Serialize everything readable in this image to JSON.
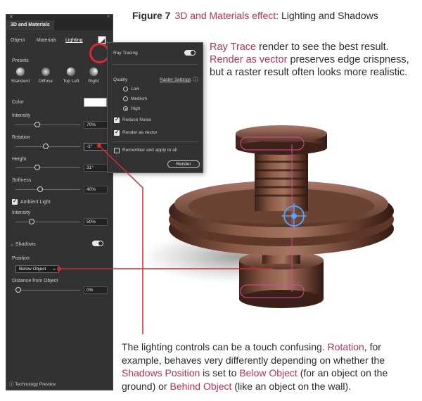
{
  "figure": {
    "number": "Figure 7",
    "title_accent": "3D and Materials effect",
    "title_rest": ": Lighting and Shadows"
  },
  "callout_top": {
    "p1_accent": "Ray Trace",
    "p1_rest": " render to see the best result.",
    "p2_accent": "Render as vector",
    "p2_rest": " preserves edge crispness, but a raster result often looks more realistic."
  },
  "callout_bottom": {
    "t1": "The lighting controls can be a touch confusing. ",
    "rotation": "Rotation",
    "t2": ", for example, behaves very differently depending on whether the ",
    "shadows_position": "Shadows Position",
    "t3": " is set to ",
    "below_object": "Below Object",
    "t4": " (for an object on the ground) or ",
    "behind_object": "Behind Object",
    "t5": " (like an object on the wall)."
  },
  "panel": {
    "tab": "3D and Materials",
    "subtabs": [
      "Object",
      "Materials",
      "Lighting"
    ],
    "presets_label": "Presets",
    "presets": [
      "Standard",
      "Diffuse",
      "Top Left",
      "Right"
    ],
    "color_label": "Color",
    "intensity_label": "Intensity",
    "intensity_value": "70%",
    "rotation_label": "Rotation",
    "rotation_value": "-1°",
    "height_label": "Height",
    "height_value": "31°",
    "softness_label": "Softness",
    "softness_value": "40%",
    "ambient_label": "Ambient Light",
    "ambient_intensity_label": "Intensity",
    "ambient_intensity_value": "50%",
    "shadows_label": "Shadows",
    "position_label": "Position",
    "position_value": "Below Object",
    "distance_label": "Distance from Object",
    "distance_value": "0%",
    "tech_preview": "Technology Preview"
  },
  "flyout": {
    "ray_tracing": "Ray Tracing",
    "quality_label": "Quality",
    "raster_settings": "Raster Settings",
    "quality_options": [
      "Low",
      "Medium",
      "High"
    ],
    "selected_quality": "High",
    "reduce_noise": "Reduce Noise",
    "render_as_vector": "Render as vector",
    "remember": "Remember and apply to all",
    "render_button": "Render"
  },
  "colors": {
    "accent": "#b5305a",
    "highlight_red": "#d62b32",
    "panel_bg": "#323232"
  }
}
